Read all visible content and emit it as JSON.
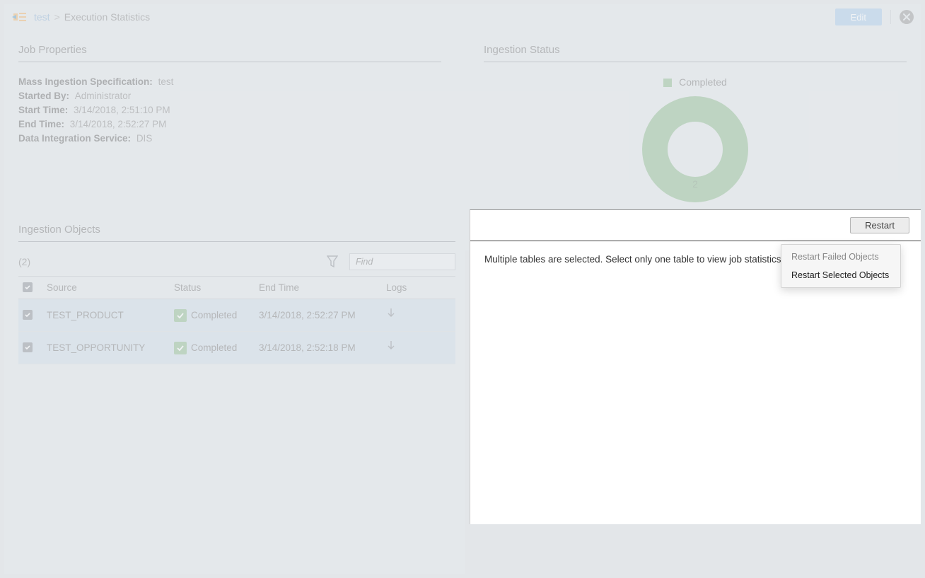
{
  "breadcrumb": {
    "link": "test",
    "current": "Execution Statistics"
  },
  "header": {
    "edit": "Edit"
  },
  "jobProperties": {
    "title": "Job Properties",
    "rows": {
      "specLabel": "Mass Ingestion Specification:",
      "specValue": "test",
      "startedByLabel": "Started By:",
      "startedByValue": "Administrator",
      "startTimeLabel": "Start Time:",
      "startTimeValue": "3/14/2018, 2:51:10 PM",
      "endTimeLabel": "End Time:",
      "endTimeValue": "3/14/2018, 2:52:27 PM",
      "disLabel": "Data Integration Service:",
      "disValue": "DIS"
    }
  },
  "ingestionStatus": {
    "title": "Ingestion Status",
    "legend": "Completed",
    "donutValue": "2"
  },
  "ingestionObjects": {
    "title": "Ingestion Objects",
    "count": "(2)",
    "findPlaceholder": "Find",
    "columns": {
      "source": "Source",
      "status": "Status",
      "endTime": "End Time",
      "logs": "Logs"
    },
    "rows": [
      {
        "source": "TEST_PRODUCT",
        "status": "Completed",
        "endTime": "3/14/2018, 2:52:27 PM"
      },
      {
        "source": "TEST_OPPORTUNITY",
        "status": "Completed",
        "endTime": "3/14/2018, 2:52:18 PM"
      }
    ]
  },
  "rightPanel": {
    "restart": "Restart",
    "message": "Multiple tables are selected. Select only one table to view job statistics.",
    "menu": {
      "failed": "Restart Failed Objects",
      "selected": "Restart Selected Objects"
    }
  },
  "chart_data": {
    "type": "pie",
    "title": "Ingestion Status",
    "series": [
      {
        "name": "Completed",
        "value": 2,
        "color": "#8fbb8f"
      }
    ]
  }
}
